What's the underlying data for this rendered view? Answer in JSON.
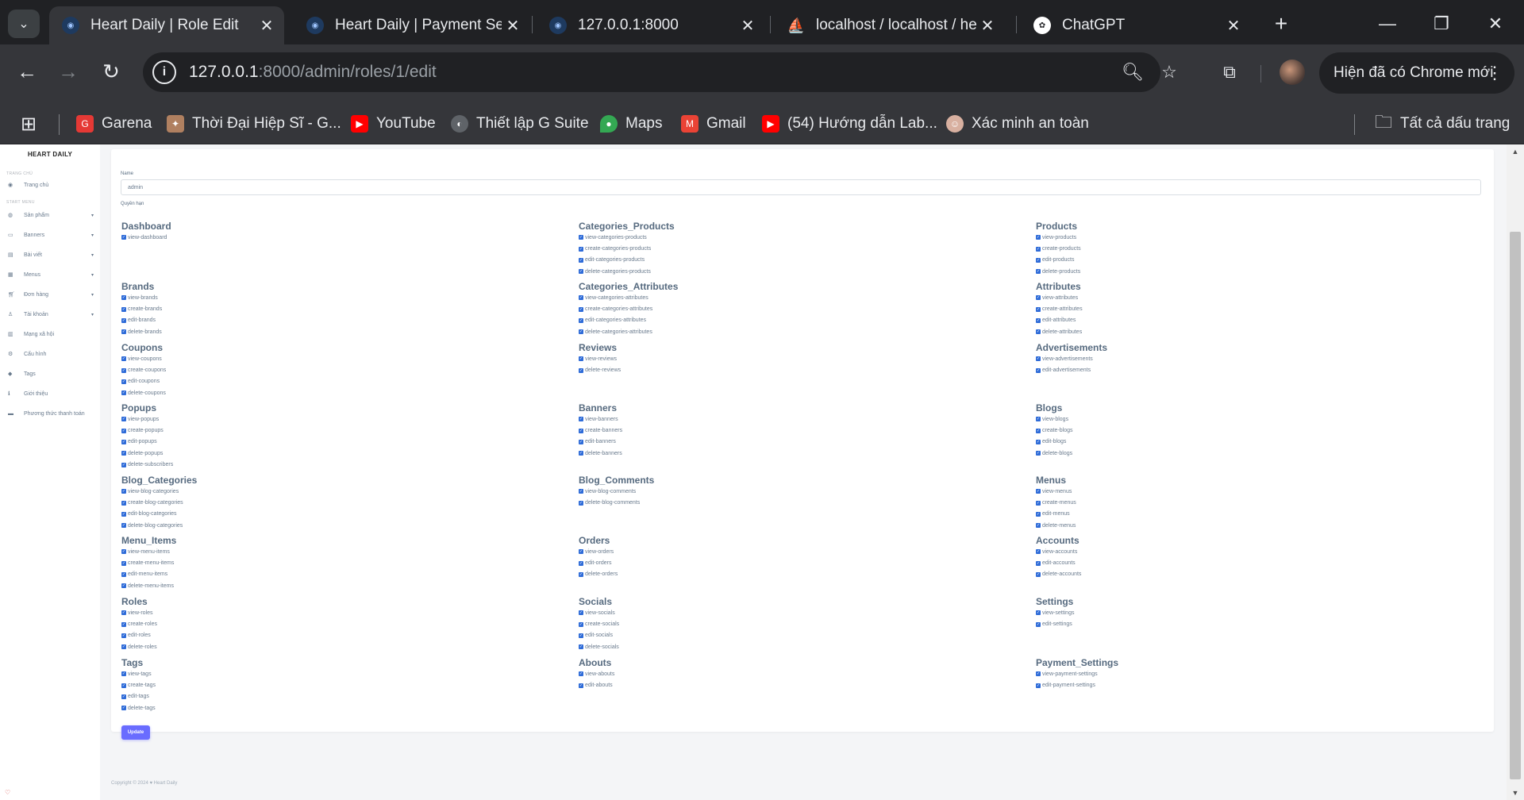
{
  "browser": {
    "tabs": [
      {
        "title": "Heart Daily | Role Edit",
        "active": true
      },
      {
        "title": "Heart Daily | Payment Set",
        "active": false
      },
      {
        "title": "127.0.0.1:8000",
        "active": false
      },
      {
        "title": "localhost / localhost / he",
        "active": false
      },
      {
        "title": "ChatGPT",
        "active": false
      }
    ],
    "url_host": "127.0.0.1",
    "url_rest": ":8000/admin/roles/1/edit",
    "update_label": "Hiện đã có Chrome mới",
    "bookmarks": [
      {
        "label": "Garena",
        "icon": "garena-icon",
        "color": "#e53935"
      },
      {
        "label": "Thời Đại Hiệp Sĩ - G...",
        "icon": "game-icon",
        "color": "#b08060"
      },
      {
        "label": "YouTube",
        "icon": "youtube-icon",
        "color": "#ff0000"
      },
      {
        "label": "Thiết lập G Suite",
        "icon": "globe-icon",
        "color": "#5f6368"
      },
      {
        "label": "Maps",
        "icon": "maps-icon",
        "color": "#34a853"
      },
      {
        "label": "Gmail",
        "icon": "gmail-icon",
        "color": "#ea4335"
      },
      {
        "label": "(54) Hướng dẫn Lab...",
        "icon": "youtube-icon",
        "color": "#ff0000"
      },
      {
        "label": "Xác minh an toàn",
        "icon": "avatar-icon",
        "color": "#d8b0a0"
      }
    ],
    "all_bookmarks_label": "Tất cả dấu trang"
  },
  "sidebar": {
    "brand": "HEART DAILY",
    "heading_home": "TRANG CHỦ",
    "home_item": "Trang chủ",
    "heading_menu": "START MENU",
    "items": [
      {
        "label": "Sản phẩm",
        "icon": "product-icon",
        "chevron": true
      },
      {
        "label": "Banners",
        "icon": "banner-icon",
        "chevron": true
      },
      {
        "label": "Bài viết",
        "icon": "post-icon",
        "chevron": true
      },
      {
        "label": "Menus",
        "icon": "menu-icon",
        "chevron": true
      },
      {
        "label": "Đơn hàng",
        "icon": "cart-icon",
        "chevron": true
      },
      {
        "label": "Tài khoản",
        "icon": "user-icon",
        "chevron": true
      },
      {
        "label": "Mạng xã hội",
        "icon": "social-icon",
        "chevron": false
      },
      {
        "label": "Cấu hình",
        "icon": "gear-icon",
        "chevron": false
      },
      {
        "label": "Tags",
        "icon": "tag-icon",
        "chevron": false
      },
      {
        "label": "Giới thiệu",
        "icon": "info-icon",
        "chevron": false
      },
      {
        "label": "Phương thức thanh toán",
        "icon": "payment-icon",
        "chevron": false
      }
    ]
  },
  "form": {
    "name_label": "Name",
    "name_value": "admin",
    "permissions_label": "Quyền hạn",
    "update_label": "Update",
    "groups": [
      {
        "title": "Dashboard",
        "perms": [
          "view-dashboard"
        ]
      },
      {
        "title": "Categories_Products",
        "perms": [
          "view-categories-products",
          "create-categories-products",
          "edit-categories-products",
          "delete-categories-products"
        ]
      },
      {
        "title": "Products",
        "perms": [
          "view-products",
          "create-products",
          "edit-products",
          "delete-products"
        ]
      },
      {
        "title": "Brands",
        "perms": [
          "view-brands",
          "create-brands",
          "edit-brands",
          "delete-brands"
        ]
      },
      {
        "title": "Categories_Attributes",
        "perms": [
          "view-categories-attributes",
          "create-categories-attributes",
          "edit-categories-attributes",
          "delete-categories-attributes"
        ]
      },
      {
        "title": "Attributes",
        "perms": [
          "view-attributes",
          "create-attributes",
          "edit-attributes",
          "delete-attributes"
        ]
      },
      {
        "title": "Coupons",
        "perms": [
          "view-coupons",
          "create-coupons",
          "edit-coupons",
          "delete-coupons"
        ]
      },
      {
        "title": "Reviews",
        "perms": [
          "view-reviews",
          "delete-reviews"
        ]
      },
      {
        "title": "Advertisements",
        "perms": [
          "view-advertisements",
          "edit-advertisements"
        ]
      },
      {
        "title": "Popups",
        "perms": [
          "view-popups",
          "create-popups",
          "edit-popups",
          "delete-popups",
          "delete-subscribers"
        ]
      },
      {
        "title": "Banners",
        "perms": [
          "view-banners",
          "create-banners",
          "edit-banners",
          "delete-banners"
        ]
      },
      {
        "title": "Blogs",
        "perms": [
          "view-blogs",
          "create-blogs",
          "edit-blogs",
          "delete-blogs"
        ]
      },
      {
        "title": "Blog_Categories",
        "perms": [
          "view-blog-categories",
          "create-blog-categories",
          "edit-blog-categories",
          "delete-blog-categories"
        ]
      },
      {
        "title": "Blog_Comments",
        "perms": [
          "view-blog-comments",
          "delete-blog-comments"
        ]
      },
      {
        "title": "Menus",
        "perms": [
          "view-menus",
          "create-menus",
          "edit-menus",
          "delete-menus"
        ]
      },
      {
        "title": "Menu_Items",
        "perms": [
          "view-menu-items",
          "create-menu-items",
          "edit-menu-items",
          "delete-menu-items"
        ]
      },
      {
        "title": "Orders",
        "perms": [
          "view-orders",
          "edit-orders",
          "delete-orders"
        ]
      },
      {
        "title": "Accounts",
        "perms": [
          "view-accounts",
          "edit-accounts",
          "delete-accounts"
        ]
      },
      {
        "title": "Roles",
        "perms": [
          "view-roles",
          "create-roles",
          "edit-roles",
          "delete-roles"
        ]
      },
      {
        "title": "Socials",
        "perms": [
          "view-socials",
          "create-socials",
          "edit-socials",
          "delete-socials"
        ]
      },
      {
        "title": "Settings",
        "perms": [
          "view-settings",
          "edit-settings"
        ]
      },
      {
        "title": "Tags",
        "perms": [
          "view-tags",
          "create-tags",
          "edit-tags",
          "delete-tags"
        ]
      },
      {
        "title": "Abouts",
        "perms": [
          "view-abouts",
          "edit-abouts"
        ]
      },
      {
        "title": "Payment_Settings",
        "perms": [
          "view-payment-settings",
          "edit-payment-settings"
        ]
      }
    ]
  },
  "footer": {
    "copyright": "Copyright © 2024 ♥ Heart Daily"
  },
  "colors": {
    "checkbox": "#2e6bd8",
    "button": "#696cff"
  }
}
